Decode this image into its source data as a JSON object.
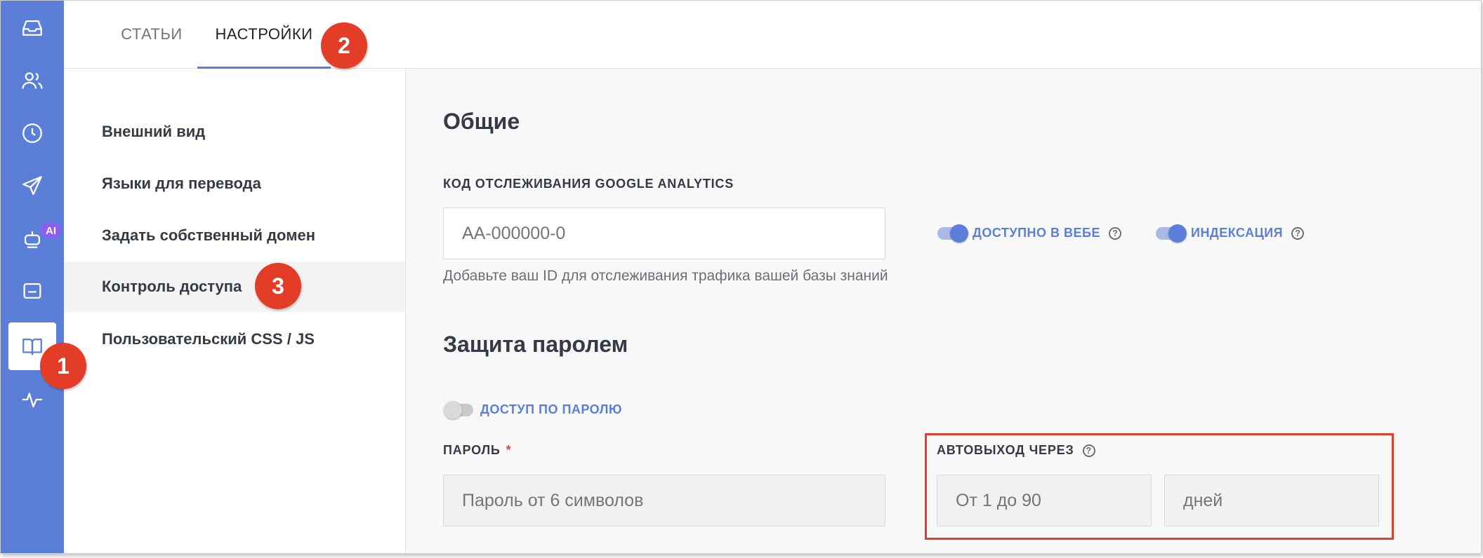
{
  "colors": {
    "accent": "#5b7fd8",
    "marker": "#e33d27",
    "highlight": "#e0402a",
    "ai_badge": "#8e5cf0"
  },
  "rail": {
    "items": [
      {
        "name": "inbox-icon"
      },
      {
        "name": "users-icon"
      },
      {
        "name": "clock-icon"
      },
      {
        "name": "send-icon"
      },
      {
        "name": "bot-icon",
        "badge": "AI"
      },
      {
        "name": "widget-icon"
      },
      {
        "name": "book-icon",
        "active": true
      },
      {
        "name": "activity-icon"
      }
    ]
  },
  "tabs": [
    {
      "label": "СТАТЬИ"
    },
    {
      "label": "НАСТРОЙКИ",
      "active": true
    }
  ],
  "menu": {
    "items": [
      {
        "label": "Внешний вид"
      },
      {
        "label": "Языки для перевода"
      },
      {
        "label": "Задать собственный домен"
      },
      {
        "label": "Контроль доступа",
        "active": true
      },
      {
        "label": "Пользовательский CSS / JS"
      }
    ]
  },
  "general": {
    "title": "Общие",
    "ga_label": "КОД ОТСЛЕЖИВАНИЯ GOOGLE ANALYTICS",
    "ga_placeholder": "AA-000000-0",
    "ga_hint": "Добавьте ваш ID для отслеживания трафика вашей базы знаний",
    "web_toggle": {
      "label": "ДОСТУПНО В ВЕБЕ",
      "on": true
    },
    "index_toggle": {
      "label": "ИНДЕКСАЦИЯ",
      "on": true
    }
  },
  "password": {
    "title": "Защита паролем",
    "toggle": {
      "label": "ДОСТУП ПО ПАРОЛЮ",
      "on": false
    },
    "password_label": "ПАРОЛЬ",
    "required_mark": "*",
    "password_placeholder": "Пароль от 6 символов",
    "autologout_label": "АВТОВЫХОД ЧЕРЕЗ",
    "autologout_placeholder": "От 1 до 90",
    "days_placeholder": "дней"
  },
  "markers": [
    "1",
    "2",
    "3"
  ]
}
